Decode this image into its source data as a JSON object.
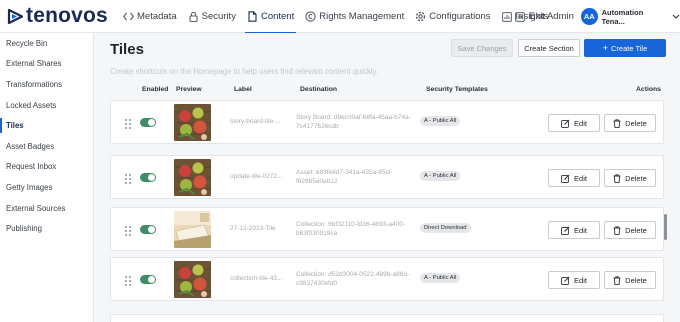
{
  "brand": {
    "name": "tenovos",
    "color": "#1a2a57",
    "accent": "#1765d8"
  },
  "nav": [
    {
      "label": "Metadata",
      "icon": "code-icon"
    },
    {
      "label": "Security",
      "icon": "lock-icon"
    },
    {
      "label": "Content",
      "icon": "file-icon",
      "active": true
    },
    {
      "label": "Rights Management",
      "icon": "copyright-icon"
    },
    {
      "label": "Configurations",
      "icon": "gear-icon"
    },
    {
      "label": "Insights",
      "icon": "chart-icon"
    }
  ],
  "exit_admin": "Exit Admin",
  "user": {
    "initials": "AA",
    "name": "Automation Tena..."
  },
  "sidebar": [
    "Recycle Bin",
    "External Shares",
    "Transformations",
    "Locked Assets",
    "Tiles",
    "Asset Badges",
    "Request Inbox",
    "Getty Images",
    "External Sources",
    "Publishing"
  ],
  "sidebar_active": "Tiles",
  "page": {
    "title": "Tiles",
    "subtitle": "Create shortcuts on the Homepage to help users find relevant content quickly.",
    "save_changes": "Save Changes",
    "create_section": "Create Section",
    "create_tile": "Create Tile"
  },
  "columns": {
    "enabled": "Enabled",
    "preview": "Preview",
    "label": "Label",
    "destination": "Destination",
    "security_templates": "Security Templates",
    "actions": "Actions"
  },
  "rows": [
    {
      "label": "story-board-tile-...",
      "destination": "Story Board: d9ec00af-68fa-45aa-b74a-7c4177626cdb",
      "security": "A - Public All",
      "enabled": true,
      "preview": "apples",
      "edit": "Edit",
      "delete": "Delete"
    },
    {
      "label": "update-tile-0272...",
      "destination": "Asset: e83fe8d7-341a-435a-85cf-f626b5a0eb12",
      "security": "A - Public All",
      "enabled": true,
      "preview": "apples",
      "edit": "Edit",
      "delete": "Delete"
    },
    {
      "label": "27-12-2023-Tile",
      "destination": "Collection: 6bf32110-fd36-4b93-a400-b63f030919ca",
      "security": "Direct Download",
      "enabled": true,
      "preview": "paper",
      "edit": "Edit",
      "delete": "Delete"
    },
    {
      "label": "collection-tile-43...",
      "destination": "Collection: d52d3004-0522-489b-a86d-c9837430efd0",
      "security": "A - Public All",
      "enabled": true,
      "preview": "apples",
      "edit": "Edit",
      "delete": "Delete"
    }
  ]
}
